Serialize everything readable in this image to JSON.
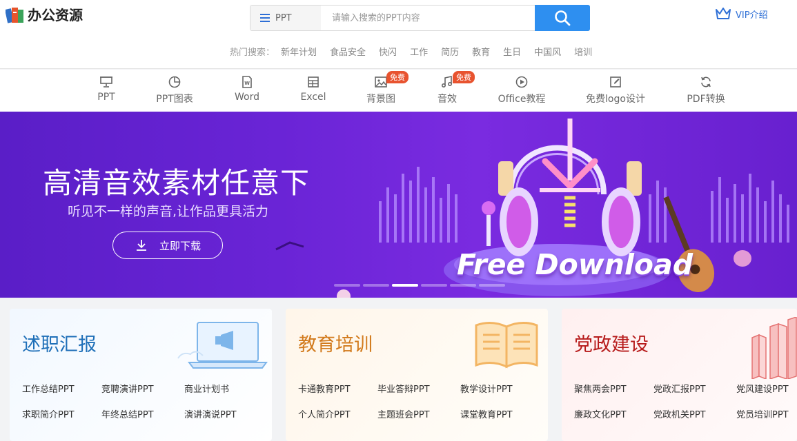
{
  "logo": {
    "text": "办公资源"
  },
  "search": {
    "type_label": "PPT",
    "placeholder": "请输入搜索的PPT内容"
  },
  "vip": {
    "label": "VIP介绍"
  },
  "hot": {
    "label": "热门搜索：",
    "items": [
      "新年计划",
      "食品安全",
      "快闪",
      "工作",
      "简历",
      "教育",
      "生日",
      "中国风",
      "培训"
    ]
  },
  "nav": {
    "items": [
      {
        "label": "PPT",
        "icon": "presentation-icon"
      },
      {
        "label": "PPT图表",
        "icon": "pie-chart-icon"
      },
      {
        "label": "Word",
        "icon": "word-icon"
      },
      {
        "label": "Excel",
        "icon": "excel-icon"
      },
      {
        "label": "背景图",
        "icon": "image-icon",
        "badge": "免费"
      },
      {
        "label": "音效",
        "icon": "music-note-icon",
        "badge": "免费"
      },
      {
        "label": "Office教程",
        "icon": "play-circle-icon"
      },
      {
        "label": "免费logo设计",
        "icon": "edit-icon"
      },
      {
        "label": "PDF转换",
        "icon": "refresh-icon"
      }
    ]
  },
  "banner": {
    "title": "高清音效素材任意下",
    "subtitle": "听见不一样的声音,让作品更具活力",
    "button": "立即下载",
    "art_text": "Free Download",
    "slides": 6,
    "active_slide": 3
  },
  "cards": [
    {
      "title": "述职汇报",
      "color": "#1e6fb8",
      "links": [
        "工作总结PPT",
        "竞聘演讲PPT",
        "商业计划书",
        "求职简介PPT",
        "年终总结PPT",
        "演讲演说PPT"
      ]
    },
    {
      "title": "教育培训",
      "color": "#d27a1c",
      "links": [
        "卡通教育PPT",
        "毕业答辩PPT",
        "教学设计PPT",
        "个人简介PPT",
        "主题班会PPT",
        "课堂教育PPT"
      ]
    },
    {
      "title": "党政建设",
      "color": "#b71c1c",
      "links": [
        "聚焦两会PPT",
        "党政汇报PPT",
        "党风建设PPT",
        "廉政文化PPT",
        "党政机关PPT",
        "党员培训PPT"
      ]
    }
  ]
}
